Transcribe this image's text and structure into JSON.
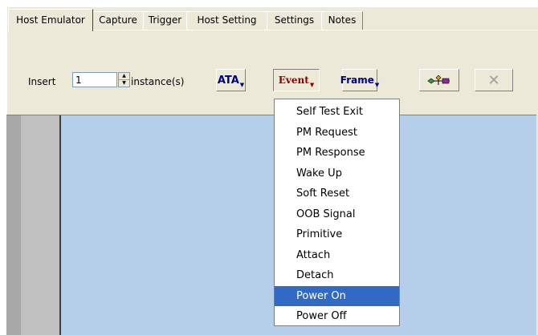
{
  "tabs": [
    "Host Emulator",
    "Capture",
    "Trigger",
    "Host Setting",
    "Settings",
    "Notes"
  ],
  "active_tab": "Host Emulator",
  "toolbar": {
    "insert_label": "Insert",
    "insert_value": "1",
    "instance_label": "instance(s)",
    "ata_label": "ATA",
    "event_label": "Event",
    "frame_label": "Frame",
    "link_icon": "link-nodes-icon",
    "delete_icon": "delete-x-icon"
  },
  "event_menu": {
    "items": [
      "Self Test Exit",
      "PM Request",
      "PM Response",
      "Wake Up",
      "Soft Reset",
      "OOB Signal",
      "Primitive",
      "Attach",
      "Detach",
      "Power On",
      "Power Off"
    ],
    "selected": "Power On"
  },
  "colors": {
    "panel_bg": "#ece9d8",
    "canvas_bg": "#b5cfeb",
    "menu_highlight": "#316ac5",
    "ata_color": "#000080",
    "event_color": "#8b0000",
    "frame_color": "#000080"
  }
}
